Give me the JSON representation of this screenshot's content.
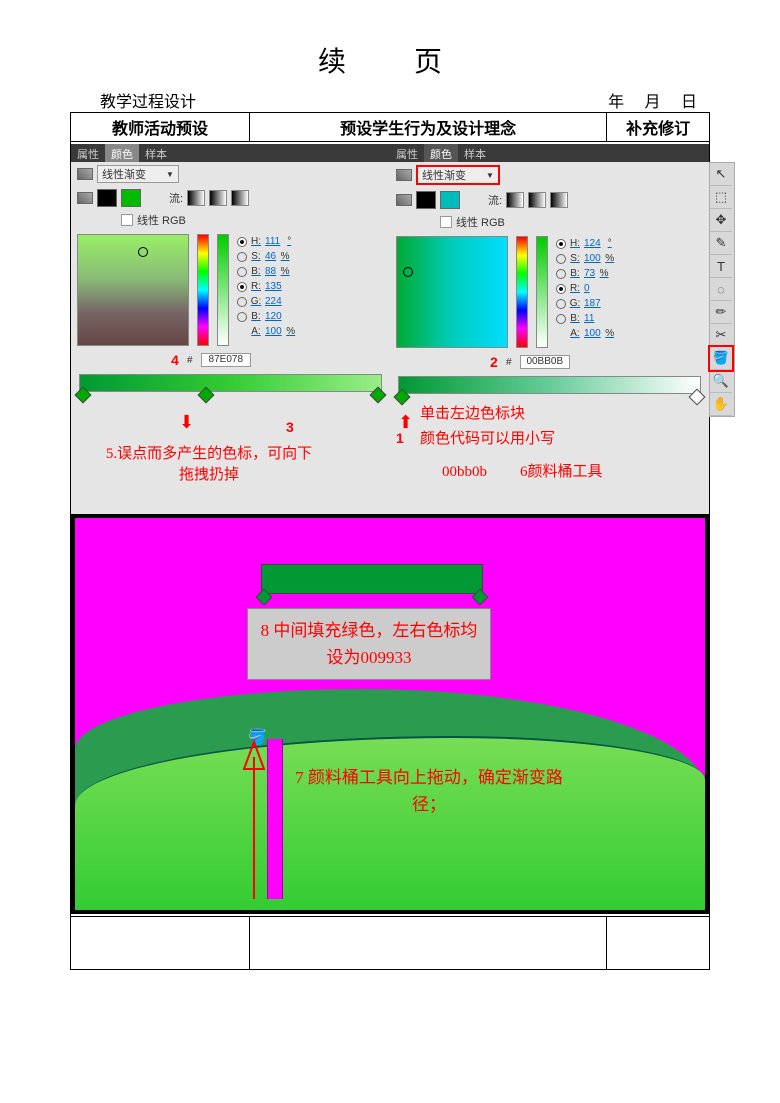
{
  "title": "续　页",
  "header_label": "教学过程设计",
  "header_date": "年 月 日",
  "columns": {
    "c1": "教师活动预设",
    "c2": "预设学生行为及设计理念",
    "c3": "补充修订"
  },
  "panel": {
    "tabs": {
      "t1": "属性",
      "t2": "颜色",
      "t3": "样本"
    },
    "gradient_type": "线性渐变",
    "flow_label": "流:",
    "linear_label": "线性 RGB"
  },
  "valsL": {
    "H": "111",
    "Hs": "°",
    "S": "46",
    "Ss": "%",
    "B": "88",
    "Bs": "%",
    "R": "135",
    "G": "224",
    "B2": "120",
    "A": "100",
    "As": "%"
  },
  "valsR": {
    "H": "124",
    "Hs": "°",
    "S": "100",
    "Ss": "%",
    "B": "73",
    "Bs": "%",
    "R": "0",
    "G": "187",
    "B2": "11",
    "A": "100",
    "As": "%"
  },
  "hexL": "87E078",
  "hexR": "00BB0B",
  "redNumL": "4",
  "redNumR": "2",
  "stripNumL": "3",
  "anno_left": "5.误点而多产生的色标，可向下拖拽扔掉",
  "anno_r_num": "1",
  "anno_r1": "单击左边色标块",
  "anno_r2": "颜色代码可以用小写",
  "anno_r3": "00bb0b",
  "anno_r4": "6颜料桶工具",
  "callout8": "8 中间填充绿色，左右色标均设为009933",
  "callout7": "7 颜料桶工具向上拖动，确定渐变路径；",
  "tools": [
    "↖",
    "⬚",
    "✥",
    "✎",
    "T",
    "◌",
    "✏",
    "✂",
    "🪣",
    "🔍",
    "✋"
  ]
}
